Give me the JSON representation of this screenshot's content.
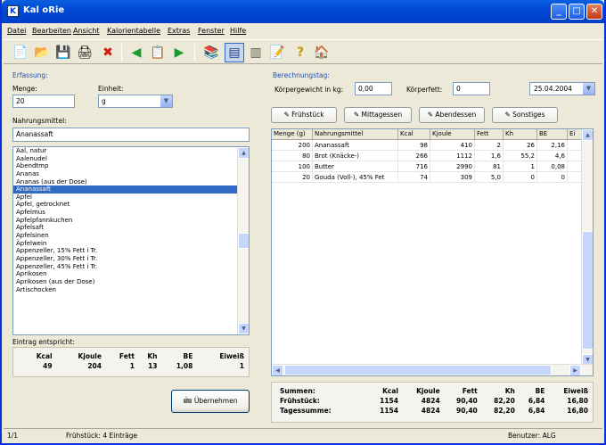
{
  "window": {
    "icon_letter": "K",
    "title": "Kal oRie",
    "minimize": "_",
    "maximize": "□",
    "close": "✕"
  },
  "menu": [
    "Datei",
    "Bearbeiten",
    "Ansicht",
    "Kalorientabelle",
    "Extras",
    "Fenster",
    "Hilfe"
  ],
  "toolbar": [
    {
      "icon": "new-document-icon",
      "glyph": "📄"
    },
    {
      "icon": "open-folder-icon",
      "glyph": "📂"
    },
    {
      "icon": "save-icon",
      "glyph": "💾"
    },
    {
      "icon": "print-icon",
      "glyph": "🖨"
    },
    {
      "icon": "delete-icon",
      "glyph": "✖"
    },
    {
      "icon": "back-icon",
      "glyph": "◀"
    },
    {
      "icon": "copy-icon",
      "glyph": "📋"
    },
    {
      "icon": "forward-icon",
      "glyph": "▶"
    },
    {
      "icon": "books-icon",
      "glyph": "📚"
    },
    {
      "icon": "table-icon",
      "glyph": "▤"
    },
    {
      "icon": "columns-icon",
      "glyph": "▥"
    },
    {
      "icon": "edit-icon",
      "glyph": "📝"
    },
    {
      "icon": "help-icon",
      "glyph": "?"
    },
    {
      "icon": "home-icon",
      "glyph": "🏠"
    }
  ],
  "colors": {
    "title_bar": "#0046d5",
    "selection": "#316ac5",
    "group_label": "#1d4fb8",
    "window_bg": "#ece9d8"
  },
  "entry": {
    "group_label": "Erfassung:",
    "menge_label": "Menge:",
    "menge_value": "20",
    "einheit_label": "Einheit:",
    "einheit_value": "g",
    "nahrungsmittel_label": "Nahrungsmittel:",
    "search_value": "Ananassaft",
    "foods": [
      "Aal, natur",
      "Aalenudel",
      "Abendtmp",
      "Ananas",
      "Ananas (aus der Dose)",
      "Ananassaft",
      "Apfel",
      "Äpfel, getrocknet",
      "Apfelmus",
      "Apfelpfannkuchen",
      "Apfelsaft",
      "Apfelsinen",
      "Äpfelwein",
      "Appenzeller, 15% Fett i Tr.",
      "Appenzeller, 30% Fett i Tr.",
      "Appenzeller, 45% Fett i Tr.",
      "Aprikosen",
      "Aprikosen (aus der Dose)",
      "Artischocken"
    ],
    "selected_index": 5,
    "summary_label": "Eintrag entspricht:",
    "summary_headers": [
      "Kcal",
      "Kjoule",
      "Fett",
      "Kh",
      "BE",
      "Eiweiß"
    ],
    "summary_values": [
      "49",
      "204",
      "1",
      "13",
      "1,08",
      "1"
    ],
    "add_button": "Übernehmen"
  },
  "diary": {
    "group_label": "Berechnungstag:",
    "weight_label": "Körpergewicht in kg:",
    "weight_value": "0,00",
    "fat_label": "Körperfett:",
    "fat_value": "0",
    "date_value": "25.04.2004",
    "tabs": [
      "Frühstück",
      "Mittagessen",
      "Abendessen",
      "Sonstiges"
    ],
    "columns": [
      "Menge (g)",
      "Nahrungsmittel",
      "Kcal",
      "Kjoule",
      "Fett",
      "Kh",
      "BE",
      "Ei"
    ],
    "rows": [
      [
        "200",
        "Ananassaft",
        "98",
        "410",
        "2",
        "26",
        "2,16",
        ""
      ],
      [
        "80",
        "Brot (Knäcke-)",
        "266",
        "1112",
        "1,6",
        "55,2",
        "4,6",
        ""
      ],
      [
        "100",
        "Butter",
        "716",
        "2990",
        "81",
        "1",
        "0,08",
        ""
      ],
      [
        "20",
        "Gouda (Voll-), 45% Fet",
        "74",
        "309",
        "5,0",
        "0",
        "0",
        ""
      ]
    ],
    "totals_headers": [
      "Summen:",
      "Kcal",
      "Kjoule",
      "Fett",
      "Kh",
      "BE",
      "Eiweiß"
    ],
    "totals_rows": [
      [
        "Frühstück:",
        "1154",
        "4824",
        "90,40",
        "82,20",
        "6,84",
        "16,80"
      ],
      [
        "Tagessumme:",
        "1154",
        "4824",
        "90,40",
        "82,20",
        "6,84",
        "16,80"
      ]
    ]
  },
  "status": {
    "position": "1/1",
    "info": "Frühstück: 4 Einträge",
    "user": "Benutzer: ALG"
  }
}
